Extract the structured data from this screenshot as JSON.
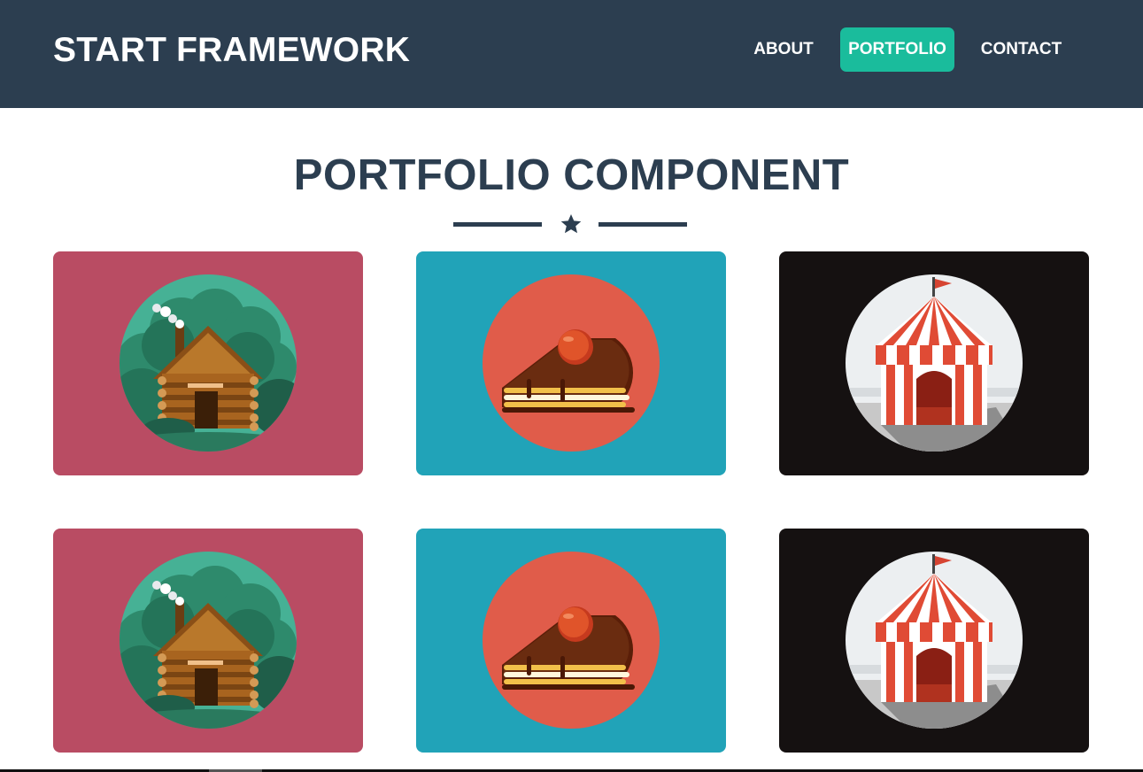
{
  "navbar": {
    "brand": "START FRAMEWORK",
    "links": [
      {
        "label": "ABOUT",
        "active": false
      },
      {
        "label": "PORTFOLIO",
        "active": true
      },
      {
        "label": "CONTACT",
        "active": false
      }
    ]
  },
  "portfolio": {
    "title": "PORTFOLIO COMPONENT",
    "divider_icon": "star-icon",
    "items": [
      {
        "image": "cabin-icon",
        "background": "#b94c63"
      },
      {
        "image": "cake-icon",
        "background": "#21a3b8"
      },
      {
        "image": "circus-tent-icon",
        "background": "#151111"
      },
      {
        "image": "cabin-icon",
        "background": "#b94c63"
      },
      {
        "image": "cake-icon",
        "background": "#21a3b8"
      },
      {
        "image": "circus-tent-icon",
        "background": "#151111"
      }
    ]
  },
  "colors": {
    "navbar": "#2c3e50",
    "accent": "#1abc9c",
    "text_dark": "#2c3e50"
  }
}
